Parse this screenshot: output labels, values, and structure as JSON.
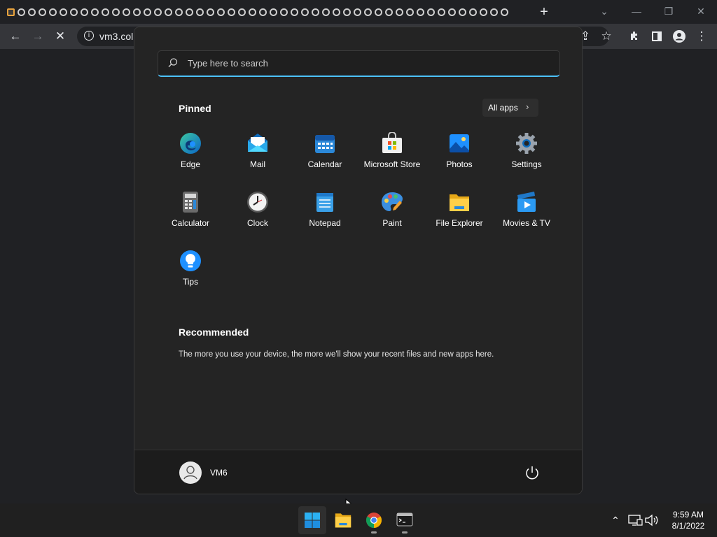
{
  "browser": {
    "tab_count": 48,
    "new_tab_icon": "plus-icon",
    "address": "vm3.coll",
    "window_controls": {
      "dropdown": "chevron-down-icon",
      "minimize": "minimize-icon",
      "restore": "restore-icon",
      "close": "close-icon"
    }
  },
  "start_menu": {
    "search_placeholder": "Type here to search",
    "pinned_title": "Pinned",
    "all_apps_label": "All apps",
    "pinned_apps": [
      {
        "label": "Edge",
        "icon": "edge-icon"
      },
      {
        "label": "Mail",
        "icon": "mail-icon"
      },
      {
        "label": "Calendar",
        "icon": "calendar-icon"
      },
      {
        "label": "Microsoft Store",
        "icon": "store-icon"
      },
      {
        "label": "Photos",
        "icon": "photos-icon"
      },
      {
        "label": "Settings",
        "icon": "settings-icon"
      },
      {
        "label": "Calculator",
        "icon": "calculator-icon"
      },
      {
        "label": "Clock",
        "icon": "clock-icon"
      },
      {
        "label": "Notepad",
        "icon": "notepad-icon"
      },
      {
        "label": "Paint",
        "icon": "paint-icon"
      },
      {
        "label": "File Explorer",
        "icon": "folder-icon"
      },
      {
        "label": "Movies & TV",
        "icon": "movies-icon"
      },
      {
        "label": "Tips",
        "icon": "tips-icon"
      }
    ],
    "recommended_title": "Recommended",
    "recommended_text": "The more you use your device, the more we'll show your recent files and new apps here.",
    "user_name": "VM6"
  },
  "taskbar": {
    "apps": [
      {
        "name": "start",
        "icon": "windows-icon"
      },
      {
        "name": "file-explorer",
        "icon": "folder-icon"
      },
      {
        "name": "chrome",
        "icon": "chrome-icon"
      },
      {
        "name": "terminal",
        "icon": "terminal-icon"
      }
    ],
    "time": "9:59 AM",
    "date": "8/1/2022"
  },
  "colors": {
    "accent": "#4cc2ff",
    "start_bg": "#242424",
    "taskbar_bg": "#202020"
  }
}
